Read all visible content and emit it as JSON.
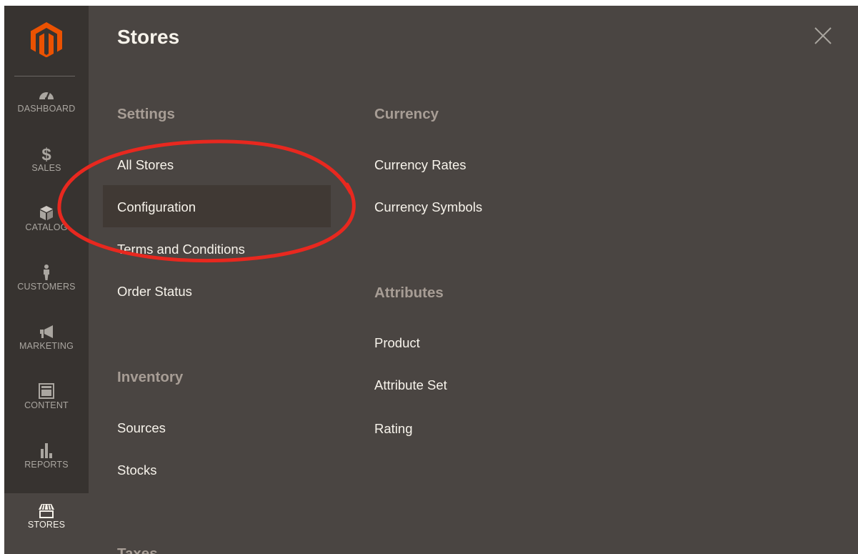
{
  "sidebar": {
    "logo_icon": "magento-logo",
    "items": [
      {
        "label": "DASHBOARD",
        "icon": "speedometer-icon"
      },
      {
        "label": "SALES",
        "icon": "dollar-icon"
      },
      {
        "label": "CATALOG",
        "icon": "box-icon"
      },
      {
        "label": "CUSTOMERS",
        "icon": "person-icon"
      },
      {
        "label": "MARKETING",
        "icon": "megaphone-icon"
      },
      {
        "label": "CONTENT",
        "icon": "layout-icon"
      },
      {
        "label": "REPORTS",
        "icon": "bar-chart-icon"
      },
      {
        "label": "STORES",
        "icon": "storefront-icon",
        "active": true
      }
    ]
  },
  "panel": {
    "title": "Stores",
    "close_icon": "close-icon",
    "settings": {
      "heading": "Settings",
      "links": [
        "All Stores",
        "Configuration",
        "Terms and Conditions",
        "Order Status"
      ]
    },
    "inventory": {
      "heading": "Inventory",
      "links": [
        "Sources",
        "Stocks"
      ]
    },
    "taxes": {
      "heading": "Taxes"
    },
    "currency": {
      "heading": "Currency",
      "links": [
        "Currency Rates",
        "Currency Symbols"
      ]
    },
    "attributes": {
      "heading": "Attributes",
      "links": [
        "Product",
        "Attribute Set",
        "Rating"
      ]
    }
  },
  "colors": {
    "sidebar_bg": "#373330",
    "panel_bg": "#4a4542",
    "brand_orange": "#eb5202",
    "highlight_bg": "#403934",
    "annotation_red": "#e8281f"
  }
}
